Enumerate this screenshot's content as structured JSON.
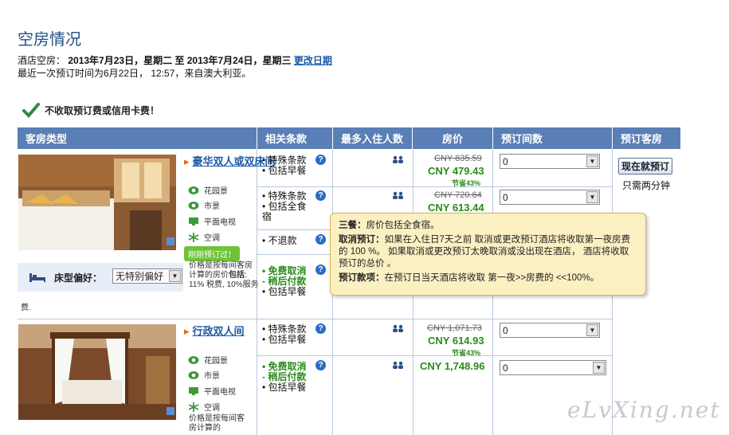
{
  "page": {
    "title": "空房情况",
    "availability_label": "酒店空房：",
    "dates_text": "2013年7月23日，星期二 至 2013年7月24日，星期三",
    "change_dates": "更改日期",
    "last_booking": "最近一次预订时间为6月22日，  12:57，来自澳大利亚。",
    "no_fee": "不收取预订费或信用卡费！"
  },
  "table": {
    "headers": [
      "客房类型",
      "相关条款",
      "最多入住人数",
      "房价",
      "预订间数",
      "预订客房"
    ]
  },
  "rooms": [
    {
      "name": "豪华双人或双床间",
      "amenities": [
        "花园景",
        "市景",
        "平面电视",
        "空调"
      ],
      "badge": "刚刚预订过！",
      "price_note_a": "价格是按每间客房计算的",
      "price_note_b": "房价",
      "price_note_c": "包括",
      "price_note_d": ": 11% 税费, 10%服务",
      "price_note_e": "费.",
      "bed_pref_label": "床型偏好：",
      "bed_pref_value": "无特别偏好",
      "options": [
        {
          "terms": [
            "• 特殊条款",
            "• 包括早餐"
          ],
          "old_price": "CNY 835.59",
          "price": "CNY 479.43",
          "save": "节省43%",
          "qty": "0"
        },
        {
          "terms": [
            "• 特殊条款",
            "• 包括全食",
            "宿"
          ],
          "old_price": "CNY 720.64",
          "price": "CNY 613.44",
          "qty": "0"
        },
        {
          "terms": [
            "• 不退款"
          ]
        },
        {
          "terms_green": [
            "• 免费取消",
            "- 稍后付款"
          ],
          "terms": [
            "• 包括早餐"
          ]
        }
      ]
    },
    {
      "name": "行政双人间",
      "amenities": [
        "花园景",
        "市景",
        "平面电视",
        "空调"
      ],
      "price_note_a": "价格是按每间客",
      "price_note_b": "房计算的",
      "options": [
        {
          "terms": [
            "• 特殊条款",
            "• 包括早餐"
          ],
          "old_price": "CNY 1,071.73",
          "price": "CNY 614.93",
          "save": "节省43%",
          "qty": "0"
        },
        {
          "terms_green": [
            "• 免费取消",
            "- 稍后付款"
          ],
          "terms": [
            "• 包括早餐"
          ],
          "price": "CNY 1,748.96",
          "qty": "0"
        }
      ]
    }
  ],
  "book": {
    "button": "现在就预订",
    "note": "只需两分钟"
  },
  "tooltip": {
    "meal_label": "三餐：",
    "meal_text": "房价包括全食宿。",
    "cancel_label": "取消预订：",
    "cancel_text": "如果在入住日7天之前 取消或更改预订酒店将收取第一夜房费的 100 %。 如果取消或更改预订太晚取消或没出现在酒店， 酒店将收取预订的总价 。",
    "pay_label": "预订款项：",
    "pay_text": "在预订日当天酒店将收取 第一夜>>房费的 <<100%。"
  },
  "watermark": "eLvXing.net",
  "colors": {
    "header_bg": "#5a7fb6",
    "price_green": "#2a8a1a",
    "link_blue": "#1a5aa8",
    "tooltip_bg": "#fbf0c2"
  }
}
